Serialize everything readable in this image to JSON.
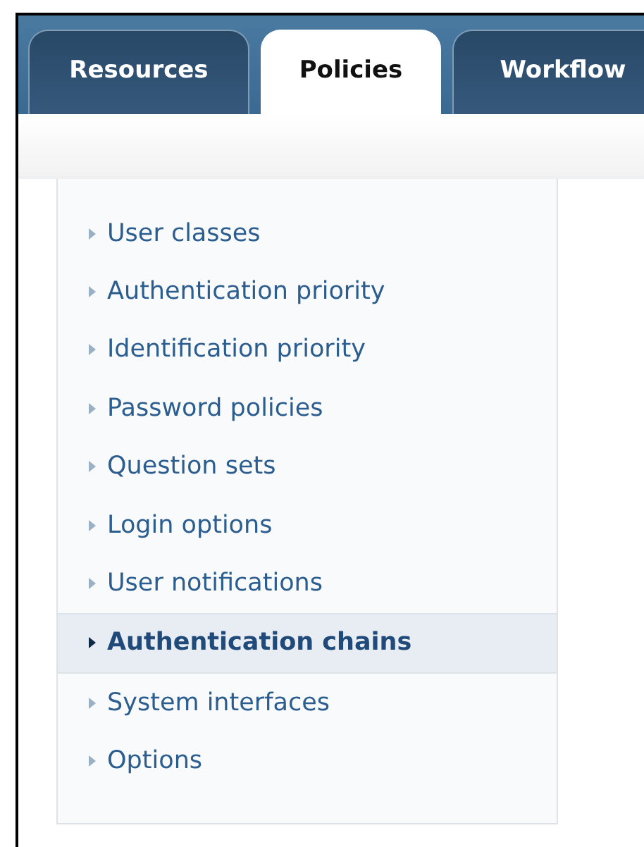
{
  "tabs": [
    {
      "label": "Resources",
      "selected": false
    },
    {
      "label": "Policies",
      "selected": true
    },
    {
      "label": "Workflow",
      "selected": false
    }
  ],
  "menu": {
    "items": [
      {
        "label": "User classes",
        "selected": false
      },
      {
        "label": "Authentication priority",
        "selected": false
      },
      {
        "label": "Identification priority",
        "selected": false
      },
      {
        "label": "Password policies",
        "selected": false
      },
      {
        "label": "Question sets",
        "selected": false
      },
      {
        "label": "Login options",
        "selected": false
      },
      {
        "label": "User notifications",
        "selected": false
      },
      {
        "label": "Authentication chains",
        "selected": true
      },
      {
        "label": "System interfaces",
        "selected": false
      },
      {
        "label": "Options",
        "selected": false
      }
    ]
  }
}
